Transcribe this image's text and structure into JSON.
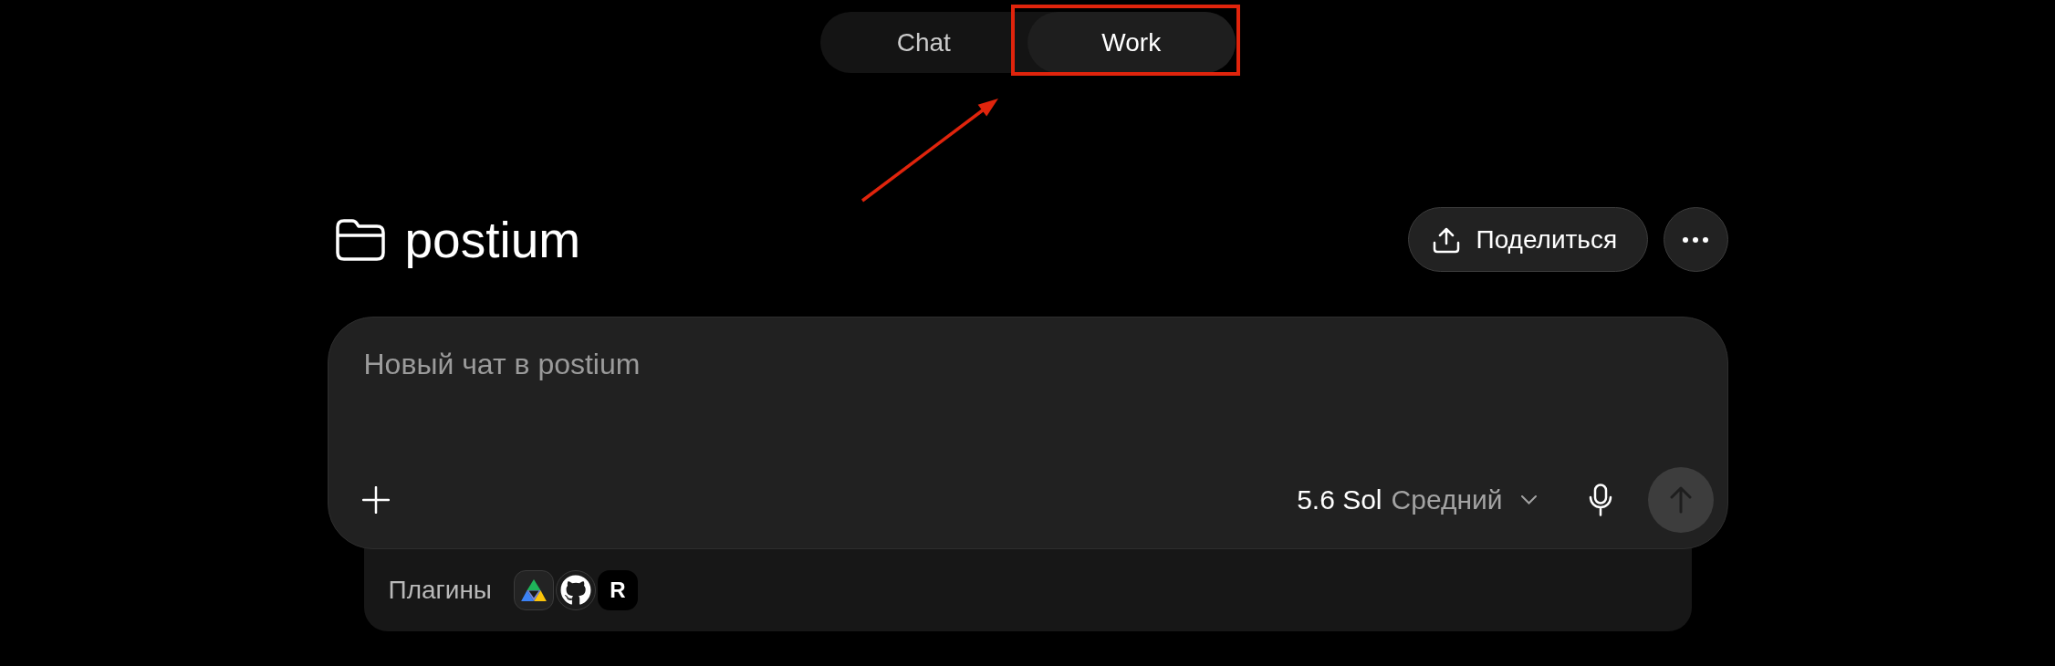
{
  "tabs": [
    {
      "label": "Chat",
      "selected": false
    },
    {
      "label": "Work",
      "selected": true
    }
  ],
  "project": {
    "name": "postium",
    "share_label": "Поделиться"
  },
  "composer": {
    "placeholder": "Новый чат в postium",
    "model": "5.6 Sol",
    "effort": "Средний",
    "send": {
      "disabled": true
    }
  },
  "plugins": {
    "label": "Плагины",
    "items": [
      {
        "kind": "triangle"
      },
      {
        "kind": "cat"
      },
      {
        "kind": "monogram",
        "glyph": "R"
      }
    ]
  }
}
